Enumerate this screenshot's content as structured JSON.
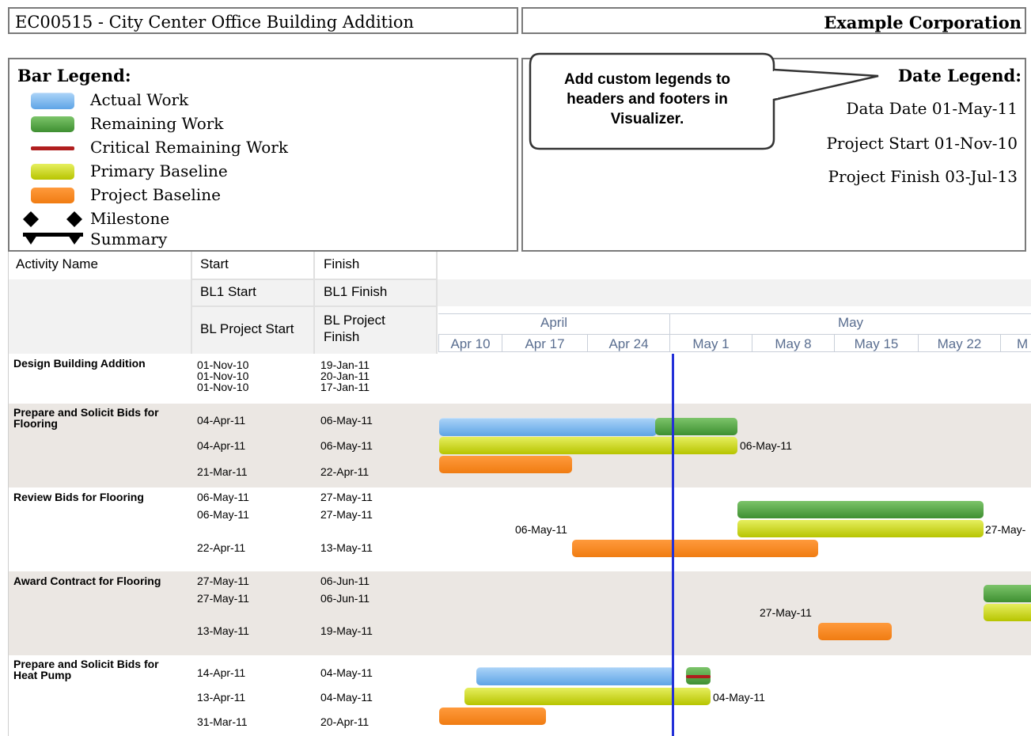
{
  "header": {
    "project_title": "EC00515 - City Center Office Building Addition",
    "company": "Example Corporation"
  },
  "bar_legend": {
    "title": "Bar Legend:",
    "items": [
      {
        "label": "Actual Work",
        "color": "#6aaeea"
      },
      {
        "label": "Remaining Work",
        "color": "#4a9e3c"
      },
      {
        "label": "Critical Remaining Work",
        "color": "#b01e1e"
      },
      {
        "label": "Primary Baseline",
        "color": "#c8d20a"
      },
      {
        "label": "Project Baseline",
        "color": "#f58220"
      },
      {
        "label": "Milestone",
        "icon": "diamond-milestone-icon"
      },
      {
        "label": "Summary",
        "icon": "summary-bar-icon"
      }
    ]
  },
  "date_legend": {
    "title": "Date Legend:",
    "data_date": "Data Date 01-May-11",
    "project_start": "Project Start 01-Nov-10",
    "project_finish": "Project Finish  03-Jul-13"
  },
  "callout": {
    "text": "Add custom legends to headers and footers in Visualizer."
  },
  "columns": {
    "activity_name": "Activity Name",
    "start": "Start",
    "finish": "Finish",
    "bl1_start": "BL1 Start",
    "bl1_finish": "BL1 Finish",
    "bl_project_start": "BL Project Start",
    "bl_project_finish": "BL Project Finish"
  },
  "timescale": {
    "months": [
      "April",
      "May"
    ],
    "weeks": [
      "Apr 10",
      "Apr 17",
      "Apr 24",
      "May 1",
      "May 8",
      "May 15",
      "May 22",
      "M"
    ]
  },
  "activities": [
    {
      "name": "Design Building Addition",
      "start": "01-Nov-10",
      "finish": "19-Jan-11",
      "bl1_start": "01-Nov-10",
      "bl1_finish": "20-Jan-11",
      "blp_start": "01-Nov-10",
      "blp_finish": "17-Jan-11"
    },
    {
      "name": "Prepare and Solicit Bids for Flooring",
      "start": "04-Apr-11",
      "finish": "06-May-11",
      "bl1_start": "04-Apr-11",
      "bl1_finish": "06-May-11",
      "blp_start": "21-Mar-11",
      "blp_finish": "22-Apr-11",
      "bar_label_1": "06-May-11"
    },
    {
      "name": "Review Bids for Flooring",
      "start": "06-May-11",
      "finish": "27-May-11",
      "bl1_start": "06-May-11",
      "bl1_finish": "27-May-11",
      "blp_start": "22-Apr-11",
      "blp_finish": "13-May-11",
      "bar_label_left": "06-May-11",
      "bar_label_right": "27-May-"
    },
    {
      "name": "Award Contract for Flooring",
      "start": "27-May-11",
      "finish": "06-Jun-11",
      "bl1_start": "27-May-11",
      "bl1_finish": "06-Jun-11",
      "blp_start": "13-May-11",
      "blp_finish": "19-May-11",
      "bar_label_left": "27-May-11"
    },
    {
      "name": "Prepare and Solicit Bids for Heat Pump",
      "start": "14-Apr-11",
      "finish": "04-May-11",
      "bl1_start": "13-Apr-11",
      "bl1_finish": "04-May-11",
      "blp_start": "31-Mar-11",
      "blp_finish": "20-Apr-11",
      "bar_label_1": "04-May-11"
    }
  ]
}
